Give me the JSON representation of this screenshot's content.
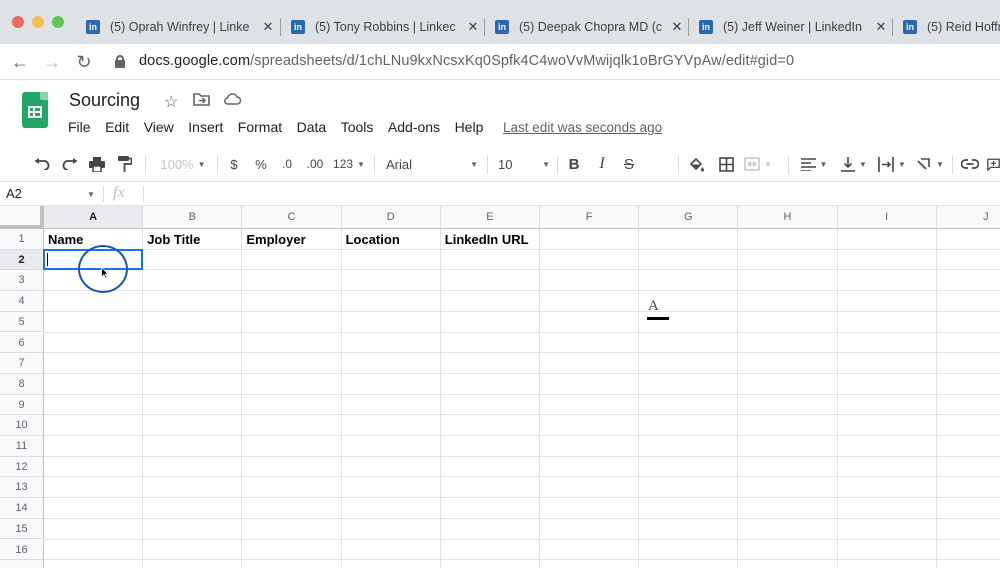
{
  "browser": {
    "tabs": [
      {
        "title": "(5) Oprah Winfrey | Linke",
        "icon": "in"
      },
      {
        "title": "(5) Tony Robbins | Linkec",
        "icon": "in"
      },
      {
        "title": "(5) Deepak Chopra MD (c",
        "icon": "in"
      },
      {
        "title": "(5) Jeff Weiner | LinkedIn",
        "icon": "in"
      },
      {
        "title": "(5) Reid Hoffr",
        "icon": "in"
      }
    ],
    "tab_close": "✕",
    "url_host": "docs.google.com",
    "url_path": "/spreadsheets/d/1chLNu9kxNcsxKq0Spfk4C4woVvMwijqlk1oBrGYVpAw/edit#gid=0"
  },
  "sheets": {
    "doc_title": "Sourcing",
    "menu": [
      "File",
      "Edit",
      "View",
      "Insert",
      "Format",
      "Data",
      "Tools",
      "Add-ons",
      "Help"
    ],
    "last_edit": "Last edit was seconds ago"
  },
  "toolbar": {
    "zoom": "100%",
    "currency": "$",
    "percent": "%",
    "decrease_decimal": ".0",
    "increase_decimal": ".00",
    "more_formats": "123",
    "font": "Arial",
    "font_size": "10",
    "bold": "B",
    "italic": "I",
    "strikethrough": "S",
    "text_color": "A"
  },
  "formula_bar": {
    "name_box": "A2",
    "fx": "fx",
    "value": ""
  },
  "grid": {
    "columns": [
      "A",
      "B",
      "C",
      "D",
      "E",
      "F",
      "G",
      "H",
      "I",
      "J"
    ],
    "rows": [
      "1",
      "2",
      "3",
      "4",
      "5",
      "6",
      "7",
      "8",
      "9",
      "10",
      "11",
      "12",
      "13",
      "14",
      "15",
      "16"
    ],
    "headers": [
      "Name",
      "Job Title",
      "Employer",
      "Location",
      "LinkedIn URL"
    ],
    "active_cell": "A2"
  },
  "colors": {
    "accent": "#1a73e8",
    "sheets_green": "#23a566",
    "linkedin": "#2867b2"
  }
}
